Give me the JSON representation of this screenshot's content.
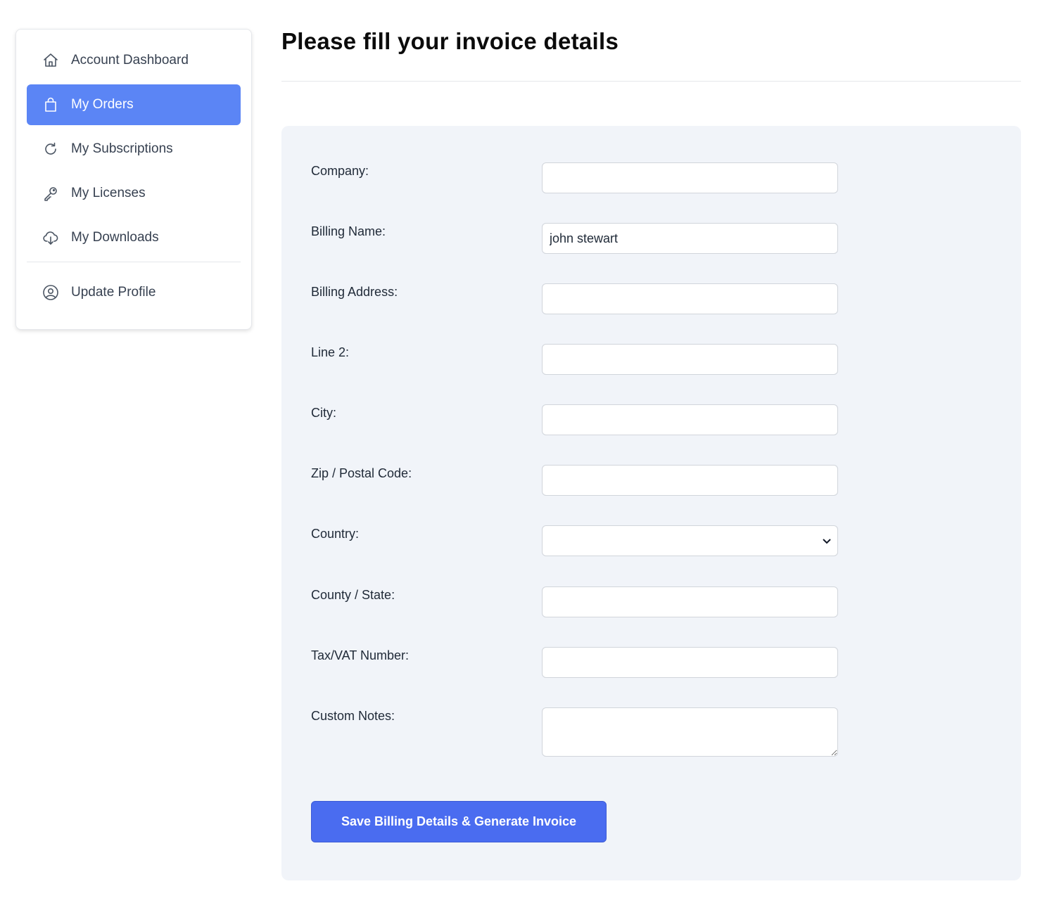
{
  "sidebar": {
    "items": [
      {
        "label": "Account Dashboard",
        "icon": "home-icon"
      },
      {
        "label": "My Orders",
        "icon": "shopping-bag-icon",
        "active": true
      },
      {
        "label": "My Subscriptions",
        "icon": "refresh-icon"
      },
      {
        "label": "My Licenses",
        "icon": "key-icon"
      },
      {
        "label": "My Downloads",
        "icon": "cloud-download-icon"
      }
    ],
    "profile": {
      "label": "Update Profile",
      "icon": "user-circle-icon"
    }
  },
  "page": {
    "title": "Please fill your invoice details"
  },
  "form": {
    "company": {
      "label": "Company:",
      "value": ""
    },
    "billing_name": {
      "label": "Billing Name:",
      "value": "john stewart"
    },
    "billing_address": {
      "label": "Billing Address:",
      "value": ""
    },
    "line2": {
      "label": "Line 2:",
      "value": ""
    },
    "city": {
      "label": "City:",
      "value": ""
    },
    "zip": {
      "label": "Zip / Postal Code:",
      "value": ""
    },
    "country": {
      "label": "Country:",
      "value": ""
    },
    "state": {
      "label": "County / State:",
      "value": ""
    },
    "tax": {
      "label": "Tax/VAT Number:",
      "value": ""
    },
    "notes": {
      "label": "Custom Notes:",
      "value": ""
    },
    "submit_label": "Save Billing Details & Generate Invoice"
  },
  "colors": {
    "accent": "#5b85f5",
    "button": "#4a6cf0",
    "panel_bg": "#f1f4f9"
  }
}
